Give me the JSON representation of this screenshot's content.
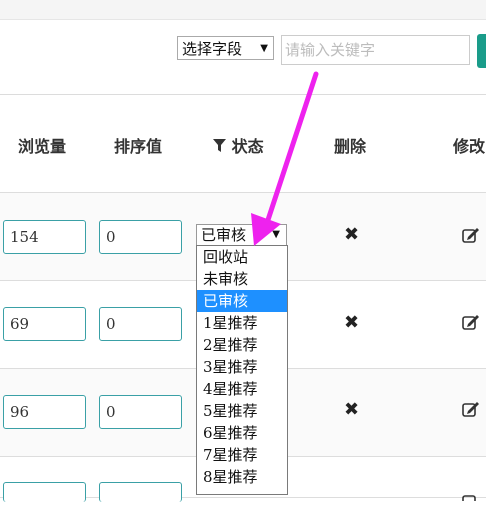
{
  "toolbar": {
    "field_select_value": "选择字段",
    "keyword_placeholder": "请输入关键字"
  },
  "table": {
    "headers": {
      "views": "浏览量",
      "sort": "排序值",
      "status": "状态",
      "delete": "删除",
      "edit": "修改"
    },
    "rows": [
      {
        "views": "154",
        "sort": "0"
      },
      {
        "views": "69",
        "sort": "0"
      },
      {
        "views": "96",
        "sort": "0"
      }
    ]
  },
  "status_dropdown": {
    "selected": "已审核",
    "options": [
      "回收站",
      "未审核",
      "已审核",
      "1星推荐",
      "2星推荐",
      "3星推荐",
      "4星推荐",
      "5星推荐",
      "6星推荐",
      "7星推荐",
      "8星推荐"
    ]
  },
  "icons": {
    "filter": "filter-icon",
    "delete": "close-icon",
    "edit": "edit-icon",
    "caret": "caret-down-icon"
  },
  "colors": {
    "annotation_arrow": "#ee22ee",
    "selected_option": "#1e90ff",
    "search_button": "#1a9c8a"
  }
}
